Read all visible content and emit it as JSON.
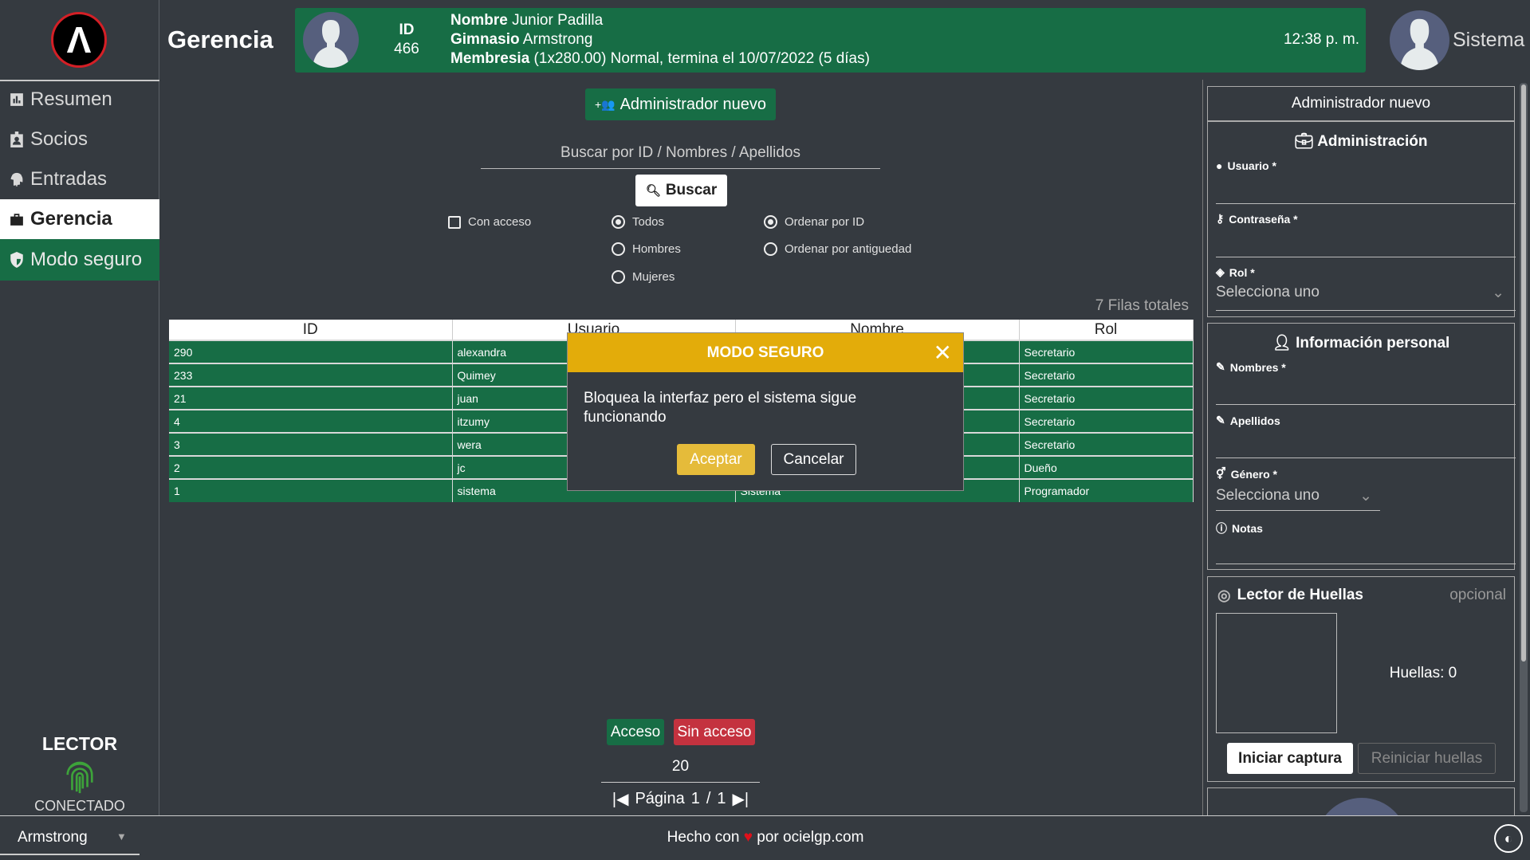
{
  "sidebar": {
    "logo_letter": "A",
    "items": [
      {
        "label": "Resumen",
        "icon": "bar-chart-icon"
      },
      {
        "label": "Socios",
        "icon": "id-badge-icon"
      },
      {
        "label": "Entradas",
        "icon": "fingerprint-icon"
      },
      {
        "label": "Gerencia",
        "icon": "briefcase-icon",
        "active": true
      },
      {
        "label": "Modo seguro",
        "icon": "shield-icon"
      }
    ],
    "reader": {
      "title": "LECTOR",
      "status": "CONECTADO",
      "color": "#3da33a"
    }
  },
  "header": {
    "title": "Gerencia",
    "banner": {
      "id_label": "ID",
      "id_value": "466",
      "name_label": "Nombre",
      "name_value": " Junior Padilla",
      "gym_label": "Gimnasio",
      "gym_value": " Armstrong",
      "membership_label": "Membresia",
      "membership_value": " (1x280.00) Normal, termina el 10/07/2022 (5 días)",
      "time": "12:38 p. m."
    },
    "user": "Sistema"
  },
  "main": {
    "new_admin_button": "Administrador nuevo",
    "search_placeholder": "Buscar por ID / Nombres / Apellidos",
    "search_button": "Buscar",
    "filters": {
      "access": "Con acceso",
      "gender": [
        "Todos",
        "Hombres",
        "Mujeres"
      ],
      "gender_selected": "Todos",
      "order": [
        "Ordenar por ID",
        "Ordenar por antiguedad"
      ],
      "order_selected": "Ordenar por ID"
    },
    "total_rows": "7 Filas totales",
    "table": {
      "columns": [
        "ID",
        "Usuario",
        "Nombre",
        "Rol"
      ],
      "rows": [
        [
          "290",
          "alexandra",
          "",
          "Secretario"
        ],
        [
          "233",
          "Quimey",
          "",
          "Secretario"
        ],
        [
          "21",
          "juan",
          "",
          "Secretario"
        ],
        [
          "4",
          "itzumy",
          "",
          "Secretario"
        ],
        [
          "3",
          "wera",
          "",
          "Secretario"
        ],
        [
          "2",
          "jc",
          "",
          "Dueño"
        ],
        [
          "1",
          "sistema",
          "Sistema",
          "Programador"
        ]
      ]
    },
    "legend": {
      "access": "Acceso",
      "no_access": "Sin acceso"
    },
    "page_size": "20",
    "pagination": {
      "label": "Página",
      "current": "1",
      "total": "1",
      "sep": "/"
    }
  },
  "modal": {
    "title": "MODO SEGURO",
    "body": "Bloquea la interfaz pero el sistema sigue funcionando",
    "accept": "Aceptar",
    "cancel": "Cancelar"
  },
  "form": {
    "title": "Administrador nuevo",
    "admin_section": "Administración",
    "user_label": "Usuario *",
    "password_label": "Contraseña *",
    "role_label": "Rol *",
    "role_value": "Selecciona uno",
    "personal_section": "Información personal",
    "names_label": "Nombres *",
    "surnames_label": "Apellidos",
    "gender_label": "Género *",
    "gender_value": "Selecciona uno",
    "notes_label": "Notas",
    "fp_title": "Lector de Huellas",
    "fp_optional": "opcional",
    "fp_count": "Huellas: 0",
    "fp_start": "Iniciar captura",
    "fp_reset": "Reiniciar huellas"
  },
  "footer": {
    "gym_select": "Armstrong",
    "credit_prefix": "Hecho con",
    "credit_suffix": "por ocielgp.com",
    "heart_color": "#e0101a"
  },
  "colors": {
    "green": "#176d45",
    "red": "#c4323f",
    "yellow": "#e3ac0a",
    "background": "#353a40"
  }
}
